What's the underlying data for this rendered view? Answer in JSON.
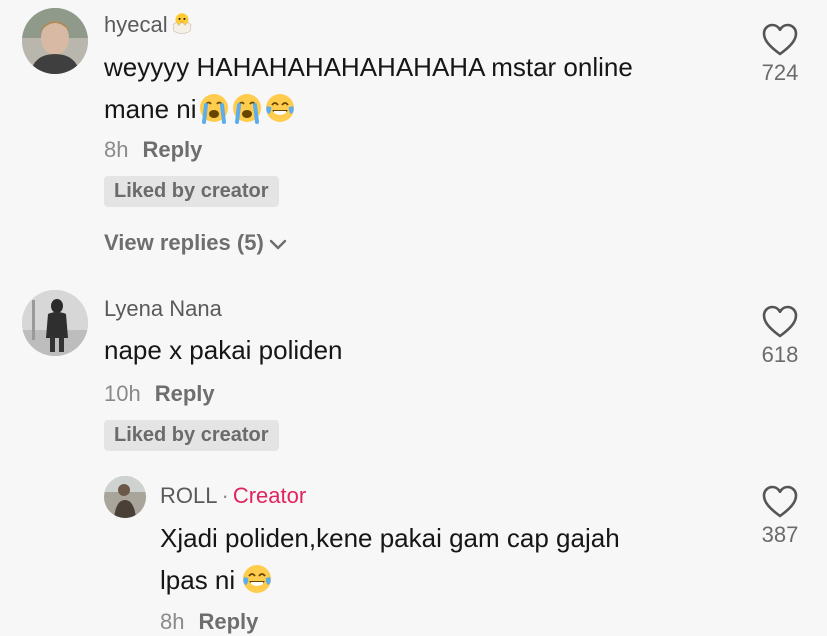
{
  "comments": [
    {
      "username": "hyecal",
      "username_emoji": "hatching-chick-icon",
      "line1": "weyyyy HAHAHAHAHAHAHAHA mstar online",
      "line2": "mane ni",
      "line2_emojis": [
        "loudly-crying-face-icon",
        "loudly-crying-face-icon",
        "face-with-tears-of-joy-icon"
      ],
      "time": "8h",
      "reply_label": "Reply",
      "liked_badge": "Liked by creator",
      "view_replies": "View replies (5)",
      "like_count": "724"
    },
    {
      "username": "Lyena Nana",
      "line1": "nape x pakai poliden",
      "time": "10h",
      "reply_label": "Reply",
      "liked_badge": "Liked by creator",
      "like_count": "618"
    },
    {
      "username": "ROLL",
      "creator_separator": "·",
      "creator_tag": "Creator",
      "line1": "Xjadi poliden,kene pakai gam cap gajah",
      "line2": "lpas ni",
      "line2_emojis": [
        "face-with-tears-of-joy-icon"
      ],
      "time": "8h",
      "reply_label": "Reply",
      "like_count": "387"
    }
  ],
  "colors": {
    "background": "#f7f7f7",
    "creator_tag": "#e0245e",
    "secondary_text": "#8a8a8a",
    "badge_bg": "#e4e4e4"
  }
}
